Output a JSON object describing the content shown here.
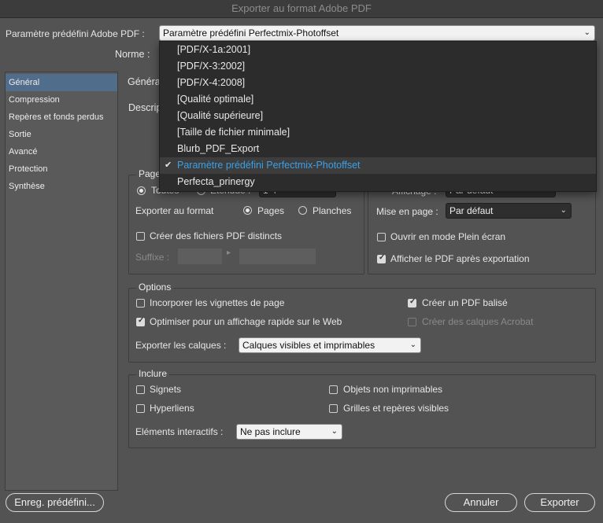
{
  "window": {
    "title": "Exporter au format Adobe PDF"
  },
  "preset": {
    "label": "Paramètre prédéfini Adobe PDF :",
    "value": "Paramètre prédéfini Perfectmix-Photoffset"
  },
  "norme": {
    "label": "Norme :"
  },
  "menu": {
    "items": [
      "[PDF/X-1a:2001]",
      "[PDF/X-3:2002]",
      "[PDF/X-4:2008]",
      "[Qualité optimale]",
      "[Qualité supérieure]",
      "[Taille de fichier minimale]",
      "Blurb_PDF_Export",
      "Paramètre prédéfini Perfectmix-Photoffset",
      "Perfecta_prinergy"
    ],
    "selected_index": 7
  },
  "sidebar": {
    "items": [
      "Général",
      "Compression",
      "Repères et fonds perdus",
      "Sortie",
      "Avancé",
      "Protection",
      "Synthèse"
    ]
  },
  "section_title": "Généra",
  "description_label": "Descrip",
  "pages_group": {
    "legend": "Page",
    "all_label": "Toutes",
    "range_label": "Étendue :",
    "range_value": "1-4",
    "export_as_label": "Exporter au format",
    "pages_option": "Pages",
    "spreads_option": "Planches",
    "separate_files": "Créer des fichiers PDF distincts",
    "suffix_label": "Suffixe :"
  },
  "view_group": {
    "display_label": "Affichage :",
    "display_value": "Par défaut",
    "layout_label": "Mise en page :",
    "layout_value": "Par défaut",
    "fullscreen": "Ouvrir en mode Plein écran",
    "view_after": "Afficher le PDF après exportation"
  },
  "options_group": {
    "legend": "Options",
    "thumbnails": "Incorporer les vignettes de page",
    "optimize": "Optimiser pour un affichage rapide sur le Web",
    "tagged": "Créer un PDF balisé",
    "acrobat_layers": "Créer des calques Acrobat",
    "export_layers_label": "Exporter les calques :",
    "export_layers_value": "Calques visibles et imprimables"
  },
  "include_group": {
    "legend": "Inclure",
    "bookmarks": "Signets",
    "hyperlinks": "Hyperliens",
    "nonprinting": "Objets non imprimables",
    "guides": "Grilles et repères visibles",
    "interactive_label": "Eléments interactifs :",
    "interactive_value": "Ne pas inclure"
  },
  "footer": {
    "save_preset": "Enreg. prédéfini...",
    "cancel": "Annuler",
    "export": "Exporter"
  },
  "colors": {
    "selection_blue": "#3aa0e8",
    "sidebar_selected": "#506e8c"
  }
}
